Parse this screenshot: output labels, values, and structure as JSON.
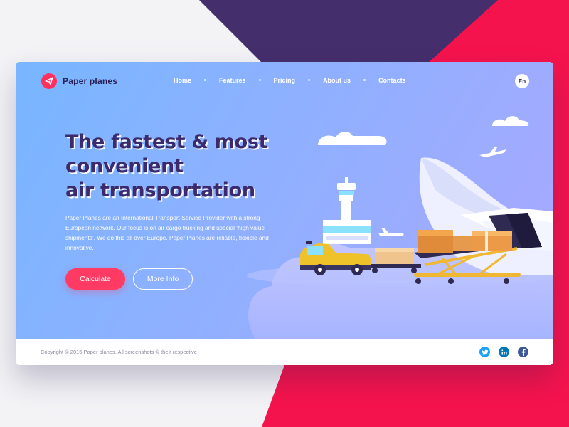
{
  "colors": {
    "accent": "#ff3a63",
    "headline": "#3b2a6e",
    "purple_shape": "#452e6c",
    "red_shape": "#f5134d",
    "twitter": "#1da1f2",
    "linkedin": "#0077b5",
    "facebook": "#3b5998"
  },
  "brand": {
    "name": "Paper planes",
    "icon": "paper-plane-icon"
  },
  "nav": {
    "items": [
      {
        "label": "Home"
      },
      {
        "label": "Features"
      },
      {
        "label": "Pricing"
      },
      {
        "label": "About us"
      },
      {
        "label": "Contacts"
      }
    ],
    "language": "En"
  },
  "hero": {
    "headline": [
      "The fastest & most",
      "convenient",
      "air transportation"
    ],
    "description": "Paper Planes are an International Transport Service Provider with a strong European network. Our focus is on air cargo trucking and special ‘high value shipments’. We do this all over Europe. Paper Planes are reliable, flexible and innovative.",
    "primary_button": "Calculate",
    "secondary_button": "More Info"
  },
  "footer": {
    "copyright": "Copyright © 2016 Paper planes.  All screenshots  ©  their respective",
    "social": [
      "twitter-icon",
      "linkedin-icon",
      "facebook-icon"
    ]
  }
}
